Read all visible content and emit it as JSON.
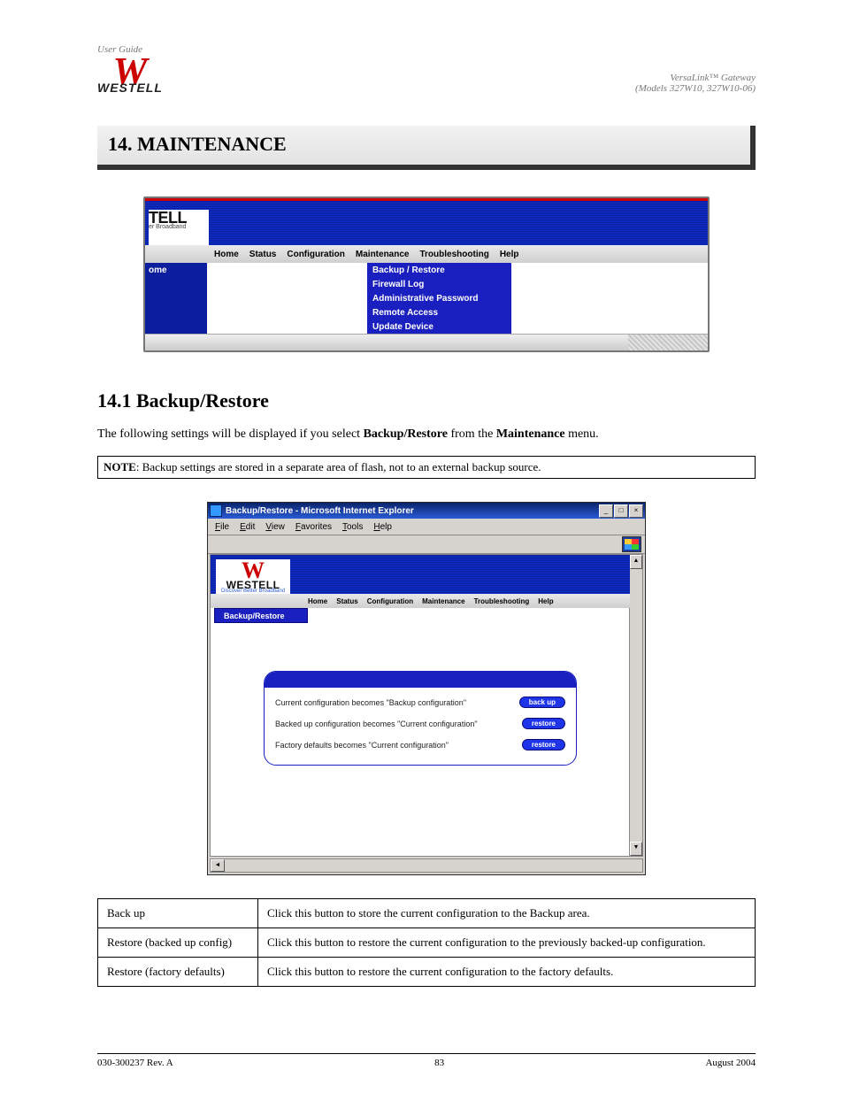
{
  "header": {
    "left_line1": "User Guide",
    "left_line2": "",
    "right_line1": "VersaLink™ Gateway",
    "right_line2": "(Models 327W10, 327W10-06)",
    "logo_word": "WESTELL"
  },
  "section_title": "14.  MAINTENANCE",
  "fig1": {
    "logo_brand": "TELL",
    "logo_sub": "er Broadband",
    "menu": [
      "Home",
      "Status",
      "Configuration",
      "Maintenance",
      "Troubleshooting",
      "Help"
    ],
    "side_label": "ome",
    "dropdown": [
      "Backup / Restore",
      "Firewall Log",
      "Administrative Password",
      "Remote Access",
      "Update Device"
    ]
  },
  "subsection_title": "14.1 Backup/Restore",
  "paragraph_parts": {
    "p1a": "The following settings will be displayed if you select ",
    "p1b": "Backup/Restore",
    "p1c": " from the ",
    "p1d": "Maintenance",
    "p1e": " menu."
  },
  "note": {
    "label": "NOTE",
    "text": ": Backup settings are stored in a separate area of flash, not to an external backup source."
  },
  "fig2": {
    "ie_title": "Backup/Restore - Microsoft Internet Explorer",
    "ie_menu": [
      "File",
      "Edit",
      "View",
      "Favorites",
      "Tools",
      "Help"
    ],
    "brand": "WESTELL",
    "tagline": "Discover Better Broadband",
    "nav": [
      "Home",
      "Status",
      "Configuration",
      "Maintenance",
      "Troubleshooting",
      "Help"
    ],
    "crumb": "Backup/Restore",
    "rows": [
      {
        "text": "Current configuration becomes \"Backup configuration\"",
        "button": "back up"
      },
      {
        "text": "Backed up configuration becomes \"Current configuration\"",
        "button": "restore"
      },
      {
        "text": "Factory defaults becomes \"Current configuration\"",
        "button": "restore"
      }
    ]
  },
  "def_table": [
    {
      "term": "Back up",
      "desc": "Click this button to store the current configuration to the Backup area."
    },
    {
      "term": "Restore (backed up config)",
      "desc": "Click this button to restore the current configuration to the previously backed-up configuration."
    },
    {
      "term": "Restore (factory defaults)",
      "desc": "Click this button to restore the current configuration to the factory defaults."
    }
  ],
  "footer": {
    "left": "030-300237 Rev. A",
    "center": "83",
    "right": "August 2004"
  }
}
